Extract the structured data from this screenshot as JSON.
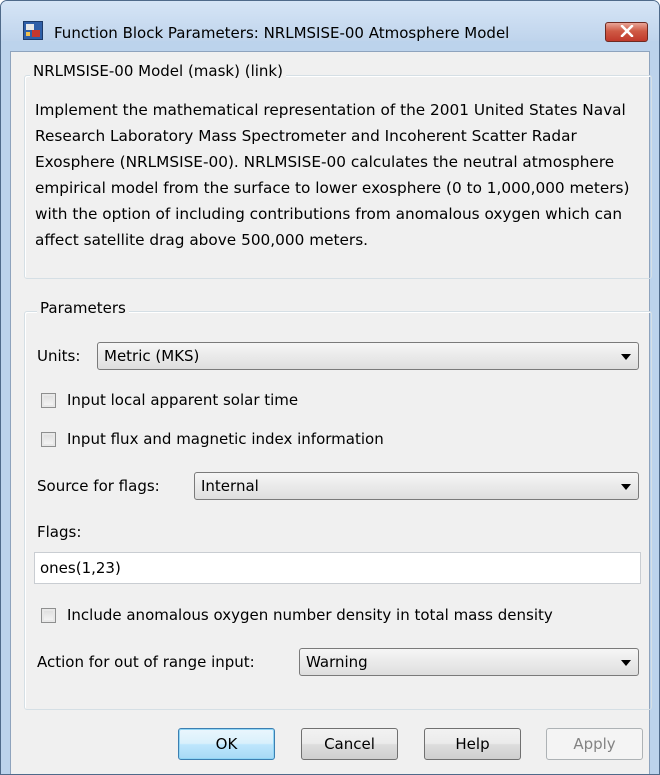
{
  "window": {
    "title": "Function Block Parameters: NRLMSISE-00 Atmosphere Model",
    "close_icon": "close-x-icon",
    "app_icon": "simulink-block-icon"
  },
  "mask": {
    "header": "NRLMSISE-00 Model (mask) (link)",
    "description": "Implement the mathematical representation of the 2001 United States Naval Research Laboratory Mass Spectrometer and Incoherent Scatter Radar Exosphere (NRLMSISE-00). NRLMSISE-00 calculates the neutral atmosphere empirical model from the surface to lower exosphere (0 to 1,000,000 meters) with the option of including contributions from anomalous oxygen which can affect satellite drag above 500,000 meters."
  },
  "parameters": {
    "header": "Parameters",
    "units": {
      "label": "Units:",
      "value": "Metric (MKS)"
    },
    "local_solar_time": {
      "label": "Input local apparent solar time",
      "checked": false
    },
    "flux_magnetic": {
      "label": "Input flux and magnetic index information",
      "checked": false
    },
    "source_flags": {
      "label": "Source for flags:",
      "value": "Internal"
    },
    "flags": {
      "label": "Flags:",
      "value": "ones(1,23)"
    },
    "anomalous_oxygen": {
      "label": "Include anomalous oxygen number density in total mass density",
      "checked": false
    },
    "out_of_range": {
      "label": "Action for out of range input:",
      "value": "Warning"
    }
  },
  "buttons": {
    "ok": "OK",
    "cancel": "Cancel",
    "help": "Help",
    "apply": "Apply"
  },
  "colors": {
    "frame": "#bcd3ec",
    "client": "#f0f0f0",
    "close_button": "#c0392b",
    "default_button": "#bee6fd"
  }
}
